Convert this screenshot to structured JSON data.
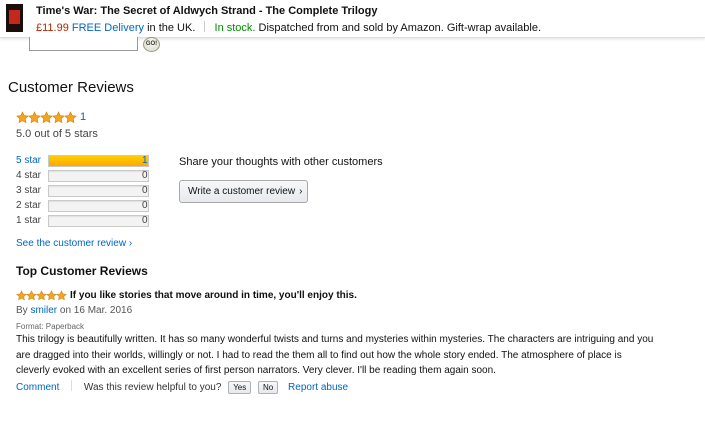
{
  "product_bar": {
    "title": "Time's War: The Secret of Aldwych Strand - The Complete Trilogy",
    "price": "£11.99",
    "delivery": "FREE Delivery",
    "delivery_suffix": "in the UK.",
    "stock": "In stock.",
    "dispatch": "Dispatched from and sold by Amazon. Gift-wrap available."
  },
  "search": {
    "go_label": "GO!"
  },
  "reviews": {
    "section_title": "Customer Reviews",
    "average_stars": 5,
    "rating_count": "1",
    "out_of": "5.0 out of 5 stars",
    "histogram": [
      {
        "label": "5 star",
        "count": "1",
        "fraction": 1.0,
        "active": true
      },
      {
        "label": "4 star",
        "count": "0",
        "fraction": 0.0,
        "active": false
      },
      {
        "label": "3 star",
        "count": "0",
        "fraction": 0.0,
        "active": false
      },
      {
        "label": "2 star",
        "count": "0",
        "fraction": 0.0,
        "active": false
      },
      {
        "label": "1 star",
        "count": "0",
        "fraction": 0.0,
        "active": false
      }
    ],
    "share_text": "Share your thoughts with other customers",
    "write_button": "Write a customer review",
    "write_chevron": "›",
    "see_all": "See the customer review ›",
    "colors": {
      "star": "#f4a41d",
      "bar_fill": "#ffb700",
      "link": "#0066c0"
    }
  },
  "top_review": {
    "section_title": "Top Customer Reviews",
    "stars": 5,
    "title": "If you like stories that move around in time, you'll enjoy this.",
    "by_prefix": "By",
    "author": "smiler",
    "date": "on 16 Mar. 2016",
    "format": "Format: Paperback",
    "body": "This trilogy is beautifully written. It has so many wonderful twists and turns and mysteries within mysteries. The characters are intriguing and you are dragged into their worlds, willingly or not. I had to read the them all to find out how the whole story ended. The atmosphere of place is cleverly evoked with an excellent series of first person narrators. Very clever. I'll be reading them again soon.",
    "comment_label": "Comment",
    "helpful_question": "Was this review helpful to you?",
    "yes_label": "Yes",
    "no_label": "No",
    "report_label": "Report abuse"
  }
}
